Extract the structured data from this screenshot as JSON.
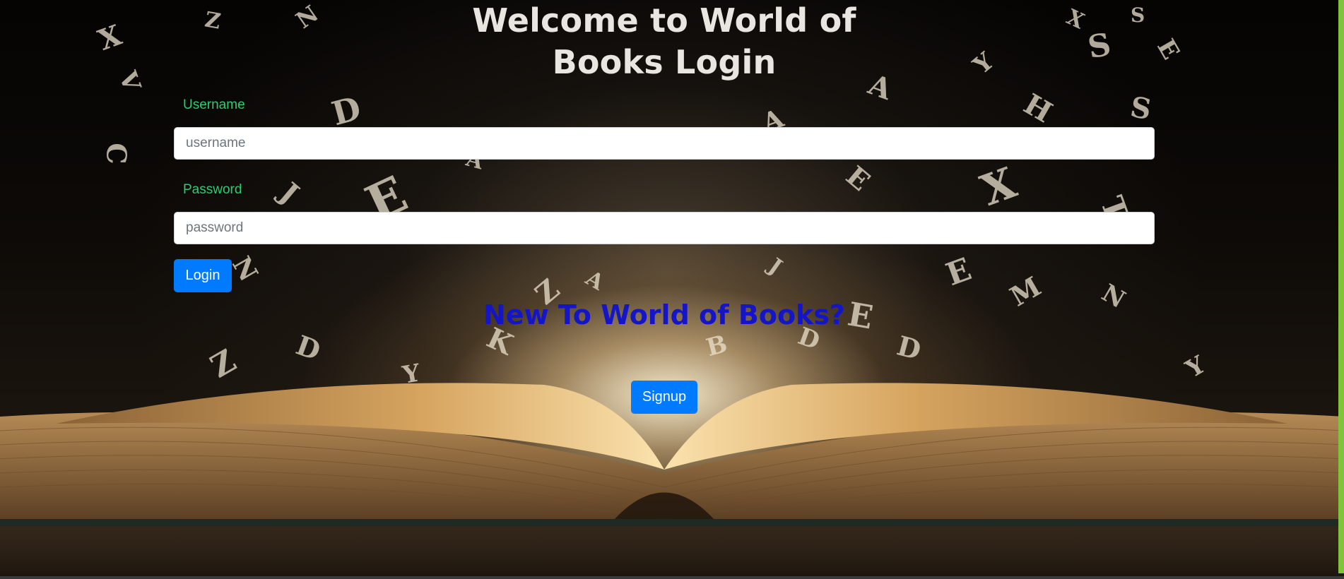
{
  "page": {
    "title": "Welcome to World of Books Login"
  },
  "form": {
    "username_label": "Username",
    "username_placeholder": "username",
    "username_value": "",
    "password_label": "Password",
    "password_placeholder": "password",
    "password_value": "",
    "login_label": "Login"
  },
  "signup": {
    "heading": "New To World of Books?",
    "button_label": "Signup"
  },
  "colors": {
    "label_green": "#2ecc71",
    "button_blue": "#007bff",
    "heading_blue": "#1515c8",
    "title_white": "#e9e6e1",
    "frame_green": "#7fc43a"
  }
}
